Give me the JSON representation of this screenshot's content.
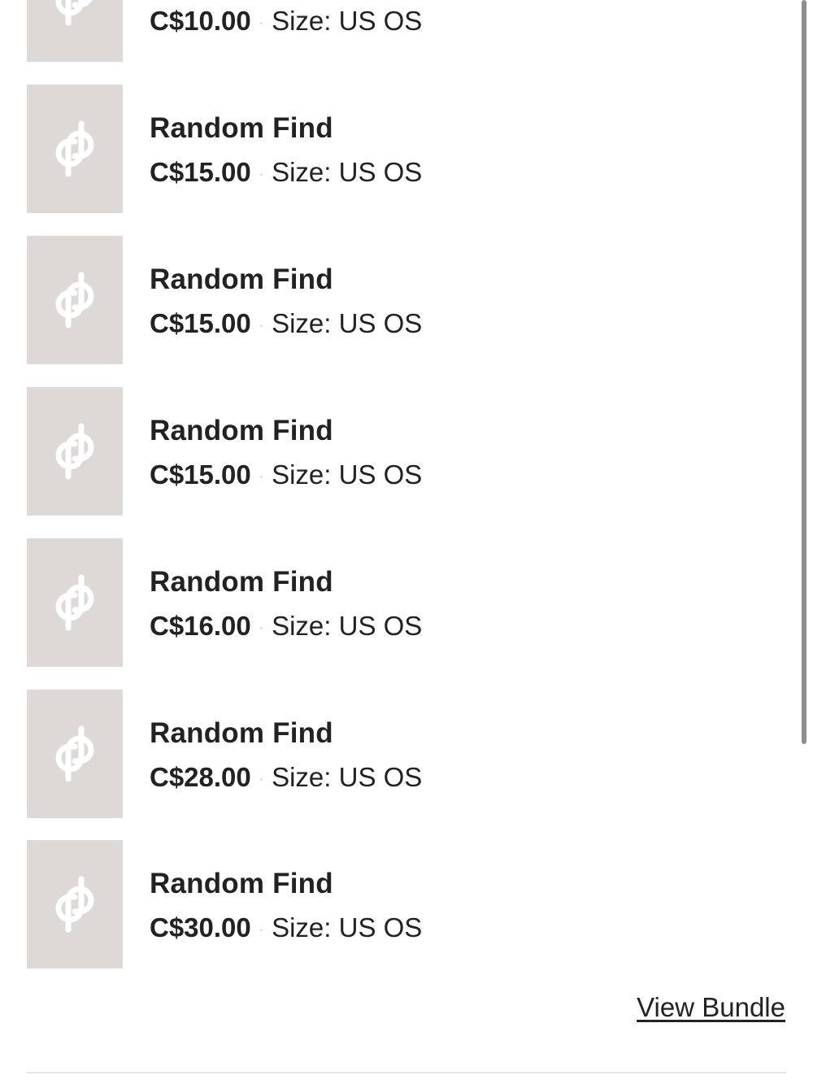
{
  "items": [
    {
      "title": "",
      "price": "C$10.00",
      "size": "Size: US OS"
    },
    {
      "title": "Random Find",
      "price": "C$15.00",
      "size": "Size: US OS"
    },
    {
      "title": "Random Find",
      "price": "C$15.00",
      "size": "Size: US OS"
    },
    {
      "title": "Random Find",
      "price": "C$15.00",
      "size": "Size: US OS"
    },
    {
      "title": "Random Find",
      "price": "C$16.00",
      "size": "Size: US OS"
    },
    {
      "title": "Random Find",
      "price": "C$28.00",
      "size": "Size: US OS"
    },
    {
      "title": "Random Find",
      "price": "C$30.00",
      "size": "Size: US OS"
    }
  ],
  "separator": "·",
  "view_bundle_label": "View Bundle",
  "colors": {
    "thumb_bg": "#dcd9d7",
    "text": "#222222",
    "divider": "#e6e6e6"
  },
  "icons": {
    "placeholder": "poshmark-logo-icon"
  }
}
